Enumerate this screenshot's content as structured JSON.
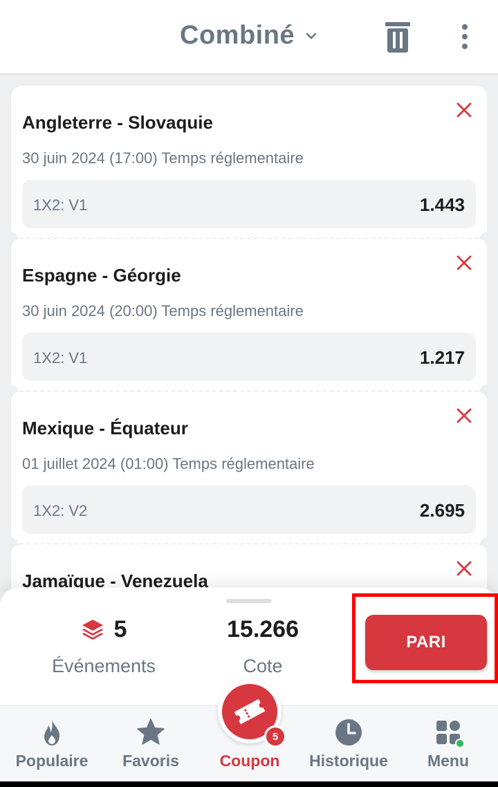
{
  "header": {
    "title": "Combiné",
    "icons": {
      "dropdown": "chevron-down-icon",
      "delete": "trash-icon",
      "more": "kebab-menu-icon"
    }
  },
  "bets": [
    {
      "match": "Angleterre - Slovaquie",
      "datetime": "30 juin 2024 (17:00) Temps réglementaire",
      "market": "1X2: V1",
      "odds": "1.443"
    },
    {
      "match": "Espagne - Géorgie",
      "datetime": "30 juin 2024 (20:00) Temps réglementaire",
      "market": "1X2: V1",
      "odds": "1.217"
    },
    {
      "match": "Mexique - Équateur",
      "datetime": "01 juillet 2024 (01:00) Temps réglementaire",
      "market": "1X2: V2",
      "odds": "2.695"
    },
    {
      "match": "Jamaïque - Venezuela",
      "datetime": "",
      "market": "",
      "odds": ""
    }
  ],
  "summary": {
    "events_count": "5",
    "events_label": "Événements",
    "total_odds": "15.266",
    "odds_label": "Cote",
    "bet_button": "PARI"
  },
  "nav": {
    "items": [
      {
        "label": "Populaire",
        "icon": "flame-icon"
      },
      {
        "label": "Favoris",
        "icon": "star-icon"
      },
      {
        "label": "Coupon",
        "icon": "ticket-icon",
        "badge": "5"
      },
      {
        "label": "Historique",
        "icon": "clock-icon"
      },
      {
        "label": "Menu",
        "icon": "grid-icon"
      }
    ]
  },
  "colors": {
    "accent": "#d7373f",
    "text_secondary": "#6a7683",
    "highlight": "#ff0000",
    "online": "#2fb861"
  }
}
